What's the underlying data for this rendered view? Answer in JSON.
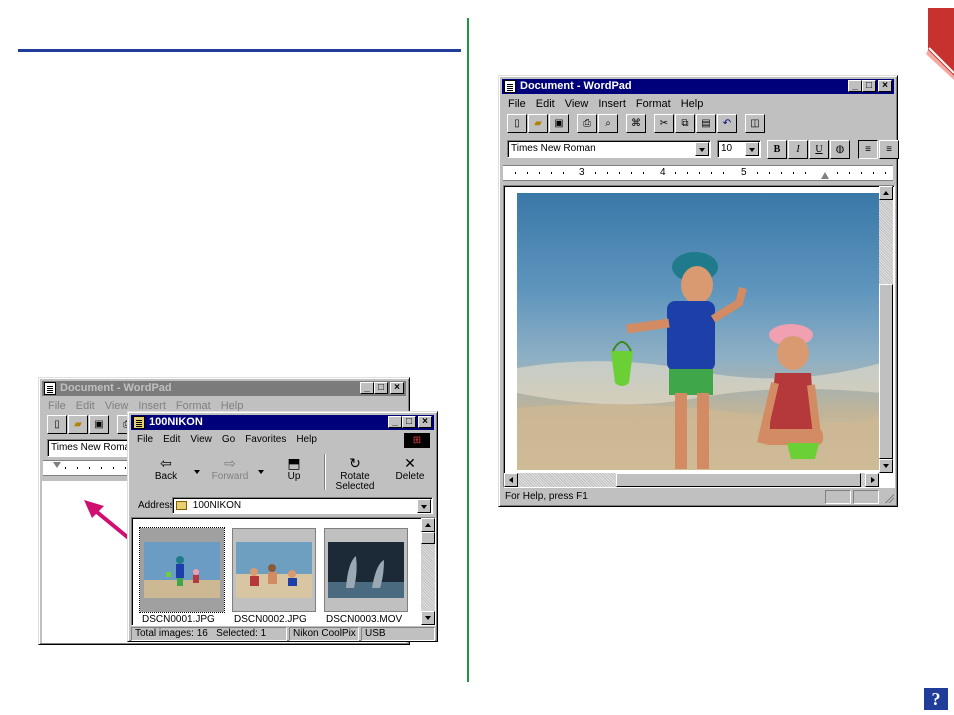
{
  "colors": {
    "accent_blue": "#1f3d99",
    "divider_green": "#1a9a3c",
    "corner_red": "#c8322e",
    "arrow_magenta": "#d01070",
    "title_active": "#00007b"
  },
  "big_wordpad": {
    "title": "Document - WordPad",
    "menu": [
      "File",
      "Edit",
      "View",
      "Insert",
      "Format",
      "Help"
    ],
    "font_name": "Times New Roman",
    "font_size": "10",
    "ruler_numbers": [
      "3",
      "4",
      "5"
    ],
    "status_text": "For Help, press F1",
    "toolbar_icons": [
      "new-icon",
      "open-icon",
      "save-icon",
      "print-icon",
      "print-preview-icon",
      "find-icon",
      "cut-icon",
      "copy-icon",
      "paste-icon",
      "undo-icon",
      "insert-datetime-icon"
    ],
    "format_buttons": [
      "B",
      "I",
      "U"
    ]
  },
  "small_wordpad": {
    "title": "Document - WordPad",
    "menu": [
      "File",
      "Edit",
      "View",
      "Insert",
      "Format",
      "Help"
    ],
    "font_name": "Times New Roman"
  },
  "explorer": {
    "title": "100NIKON",
    "menu": [
      "File",
      "Edit",
      "View",
      "Go",
      "Favorites",
      "Help"
    ],
    "buttons": [
      {
        "label": "Back",
        "icon": "back-arrow-icon"
      },
      {
        "label": "Forward",
        "icon": "forward-arrow-icon"
      },
      {
        "label": "Up",
        "icon": "folder-up-icon"
      },
      {
        "label": "Rotate Selected",
        "icon": "rotate-icon"
      },
      {
        "label": "Delete",
        "icon": "delete-x-icon"
      }
    ],
    "address_label": "Address",
    "address_value": "100NIKON",
    "files": [
      "DSCN0001.JPG",
      "DSCN0002.JPG",
      "DSCN0003.MOV"
    ],
    "status_total": "Total images: 16",
    "status_selected": "Selected: 1",
    "status_device": "Nikon CoolPix",
    "status_port": "USB"
  },
  "help_icon_label": "?"
}
